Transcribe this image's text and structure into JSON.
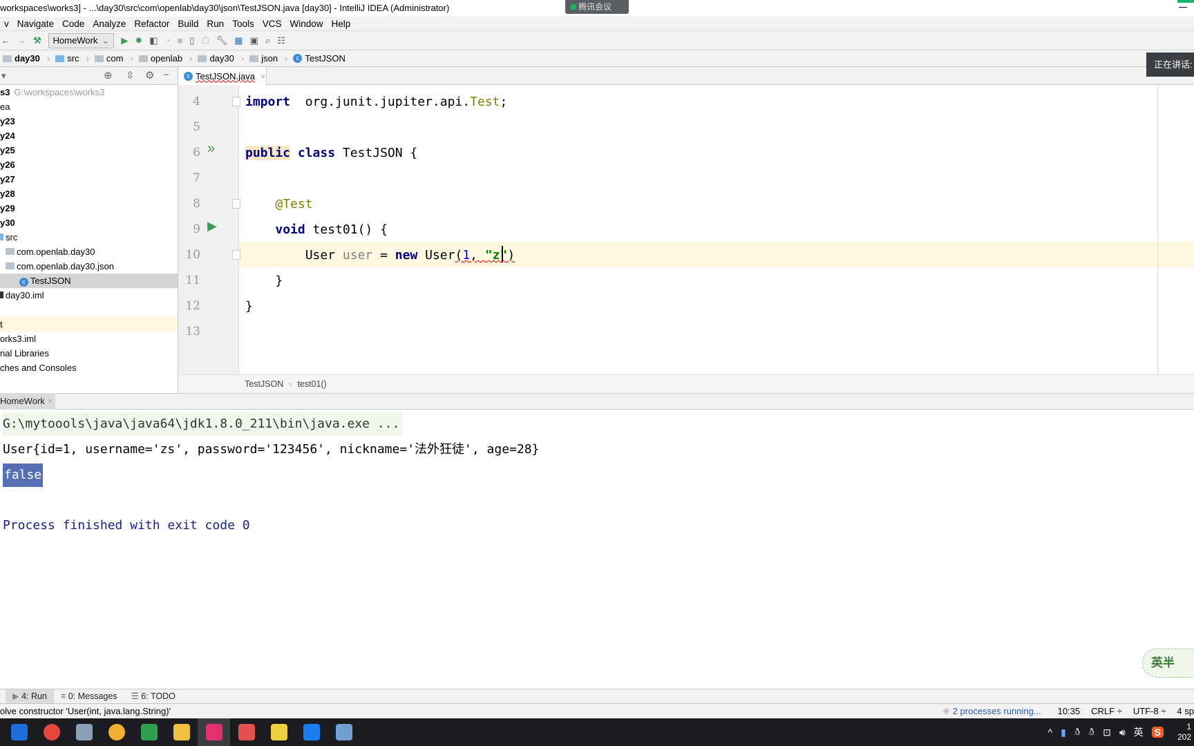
{
  "window": {
    "title": "workspaces\\works3] - ...\\day30\\src\\com\\openlab\\day30\\json\\TestJSON.java [day30] - IntelliJ IDEA (Administrator)"
  },
  "overlay": {
    "meeting_label": "腾讯会议",
    "speaking_tooltip": "正在讲话: ",
    "watermark": "英半"
  },
  "menu": [
    "v",
    "Navigate",
    "Code",
    "Analyze",
    "Refactor",
    "Build",
    "Run",
    "Tools",
    "VCS",
    "Window",
    "Help"
  ],
  "toolbar": {
    "run_config": "HomeWork",
    "icons": [
      "back-icon",
      "forward-icon",
      "build-hammer-icon",
      "run-icon",
      "debug-icon",
      "coverage-icon",
      "profile-icon",
      "stop-icon",
      "device-icon",
      "attach-icon",
      "settings-wrench-icon",
      "project-structure-icon",
      "terminal-icon",
      "search-icon",
      "sdk-icon"
    ]
  },
  "navbar": [
    "day30",
    "src",
    "com",
    "openlab",
    "day30",
    "json",
    "TestJSON"
  ],
  "project": {
    "items": [
      {
        "label": "s3",
        "extra": "G:\\workspaces\\works3",
        "bold": true
      },
      {
        "label": "ea"
      },
      {
        "label": "y23",
        "bold": true
      },
      {
        "label": "y24",
        "bold": true
      },
      {
        "label": "y25",
        "bold": true
      },
      {
        "label": "y26",
        "bold": true
      },
      {
        "label": "y27",
        "bold": true
      },
      {
        "label": "y28",
        "bold": true
      },
      {
        "label": "y29",
        "bold": true
      },
      {
        "label": "y30",
        "bold": true
      },
      {
        "label": "src"
      },
      {
        "label": "com.openlab.day30"
      },
      {
        "label": "com.openlab.day30.json"
      },
      {
        "label": "TestJSON",
        "selected": true
      },
      {
        "label": "day30.iml"
      },
      {
        "label": ""
      },
      {
        "label": "t"
      },
      {
        "label": "orks3.iml"
      },
      {
        "label": "nal Libraries"
      },
      {
        "label": "ches and Consoles"
      }
    ]
  },
  "editor": {
    "tab": "TestJSON.java",
    "lines": [
      {
        "n": "4",
        "tokens": [
          [
            "kw",
            "import"
          ],
          [
            "",
            "  org.junit.jupiter.api."
          ],
          [
            "imp",
            "Test"
          ],
          [
            "",
            ";"
          ]
        ]
      },
      {
        "n": "5",
        "tokens": []
      },
      {
        "n": "6",
        "tokens": [
          [
            "kw pubhl",
            "public"
          ],
          [
            "",
            ""
          ],
          [
            "kw",
            " class"
          ],
          [
            "",
            " TestJSON {"
          ]
        ]
      },
      {
        "n": "7",
        "tokens": []
      },
      {
        "n": "8",
        "tokens": [
          [
            "",
            "    "
          ],
          [
            "ann",
            "@Test"
          ]
        ]
      },
      {
        "n": "9",
        "tokens": [
          [
            "",
            "    "
          ],
          [
            "kw",
            "void"
          ],
          [
            "",
            " test01() {"
          ]
        ]
      },
      {
        "n": "10",
        "tokens": [
          [
            "",
            "        User "
          ],
          [
            "unused",
            "user"
          ],
          [
            "",
            " = "
          ],
          [
            "kw",
            "new"
          ],
          [
            "",
            " User"
          ],
          [
            "err",
            "("
          ],
          [
            "num err",
            "1"
          ],
          [
            "err",
            ", "
          ],
          [
            "str err",
            "\"z\""
          ],
          [
            "err",
            ")"
          ]
        ]
      },
      {
        "n": "11",
        "tokens": [
          [
            "",
            "    }"
          ]
        ]
      },
      {
        "n": "12",
        "tokens": [
          [
            "",
            "}"
          ]
        ]
      },
      {
        "n": "13",
        "tokens": []
      }
    ],
    "breadcrumb": [
      "TestJSON",
      "test01()"
    ]
  },
  "run": {
    "tab": "HomeWork",
    "output": [
      "G:\\mytoools\\java\\java64\\jdk1.8.0_211\\bin\\java.exe ...",
      "User{id=1, username='zs', password='123456', nickname='法外狂徒', age=28}",
      "false",
      "Process finished with exit code 0"
    ]
  },
  "bottom_tabs": [
    "4: Run",
    "0: Messages",
    "6: TODO"
  ],
  "status": {
    "message": "olve constructor 'User(int, java.lang.String)'",
    "processes": "2 processes running...",
    "position": "10:35",
    "line_sep": "CRLF ÷",
    "encoding": "UTF-8 ÷",
    "indent": "4 sp"
  },
  "taskbar": {
    "apps": [
      "edge",
      "chrome",
      "monitor",
      "app-yellow",
      "vnc",
      "file-explorer",
      "intellij",
      "notes",
      "help",
      "meeting",
      "paint"
    ],
    "tray_lang": "英",
    "clock": "1",
    "date": "202"
  },
  "colors": {
    "accent": "#3f9a57",
    "selection": "#5470b2",
    "current_line": "#fdf8e0"
  }
}
